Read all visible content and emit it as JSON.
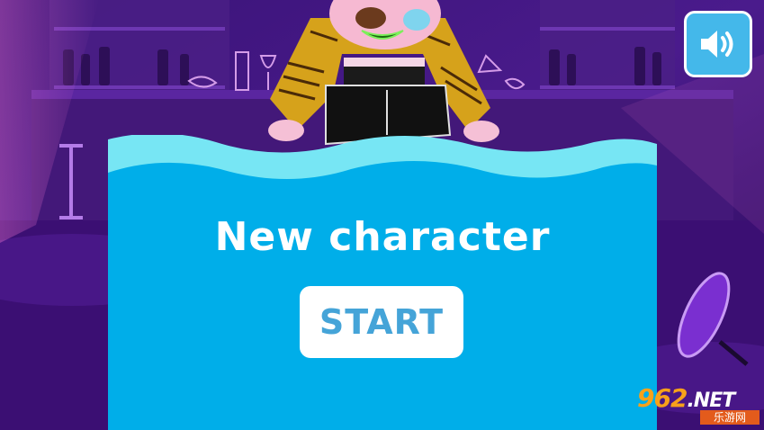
{
  "screen": {
    "title": "New character",
    "start_label": "START",
    "sound_icon": "speaker-volume-icon"
  },
  "watermark": {
    "logo_text": "962",
    "logo_suffix": ".NET",
    "subtitle": "乐游网"
  },
  "colors": {
    "panel": "#00aee9",
    "wave_light": "#77e6f4",
    "button_text": "#45a4d8",
    "background": "#3b0f73"
  }
}
